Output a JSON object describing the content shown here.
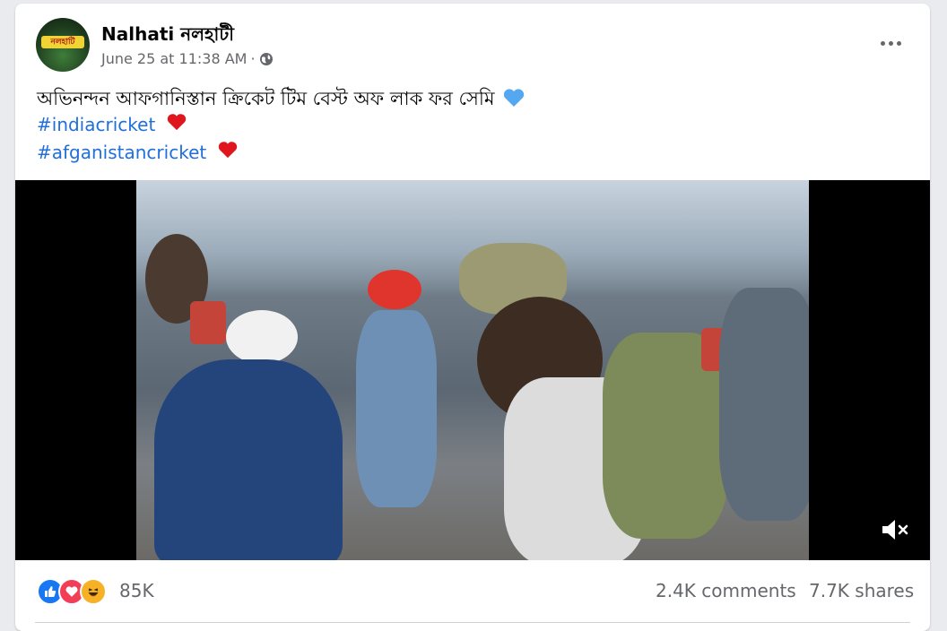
{
  "post": {
    "author": "Nalhati নলহাটী",
    "avatar_text": "নলহাটি",
    "timestamp": "June 25 at 11:38 AM",
    "separator": "·",
    "privacy_icon": "globe-icon",
    "text": "অভিনন্দন আফগানিস্তান ক্রিকেট টিম  বেস্ট অফ লাক ফর সেমি",
    "hashtags": [
      "#indiacricket",
      "#afganistancricket"
    ]
  },
  "video": {
    "muted": true,
    "mute_icon": "speaker-muted-icon"
  },
  "footer": {
    "reactions": [
      "like-icon",
      "love-icon",
      "haha-icon"
    ],
    "reaction_count": "85K",
    "comments": "2.4K comments",
    "shares": "7.7K shares"
  },
  "colors": {
    "hashtag": "#216fdb",
    "like": "#1877f2",
    "love": "#f33e58",
    "haha": "#f7b125",
    "heart_red": "#e0161d",
    "heart_blue": "#55a7ef"
  }
}
